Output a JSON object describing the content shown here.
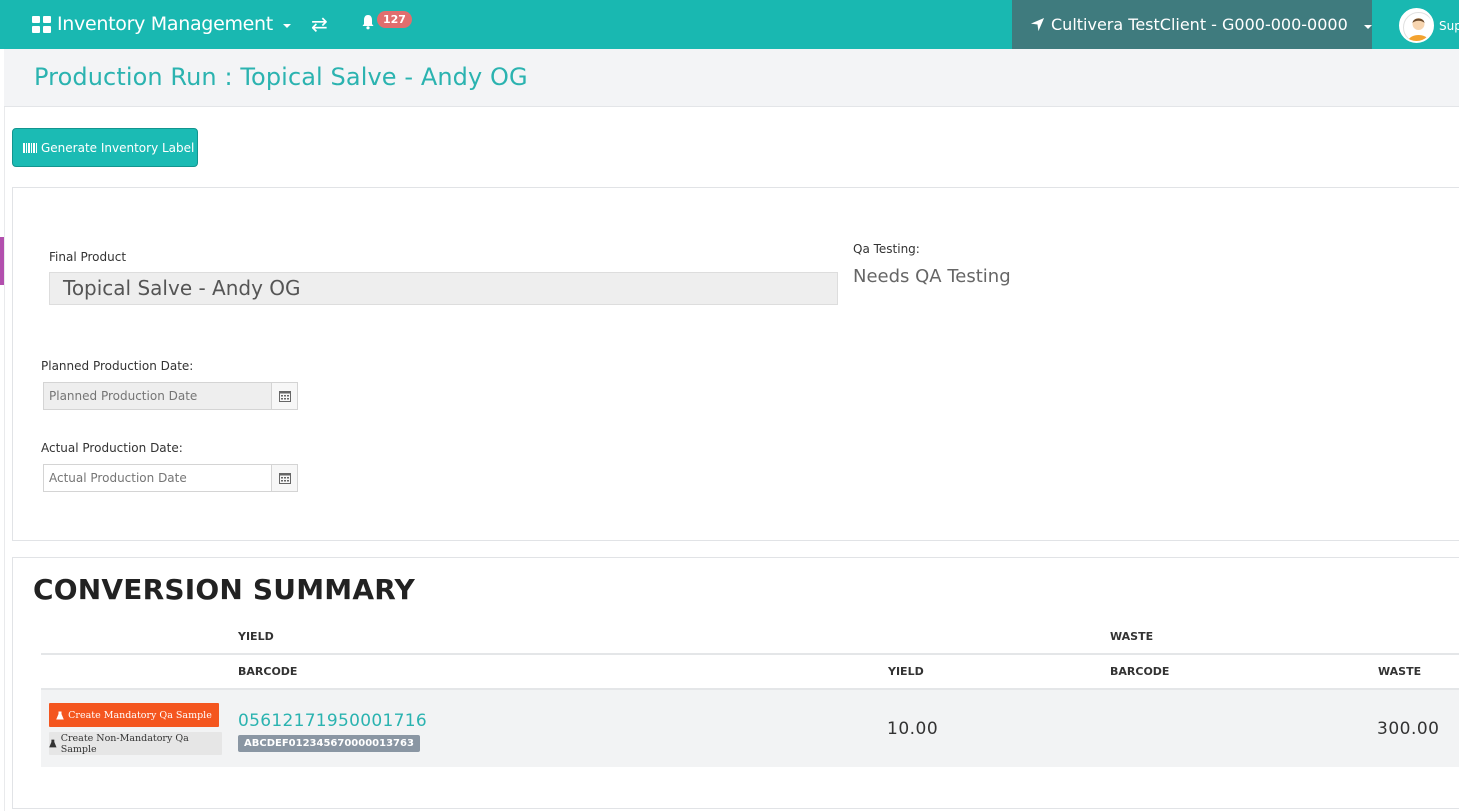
{
  "navbar": {
    "app_title": "Inventory Management",
    "notification_count": "127",
    "location": "Cultivera TestClient - G000-000-0000",
    "user_label": "Sup",
    "icons": {
      "app": "grid-icon",
      "swap": "swap-icon",
      "notifications": "bell-icon",
      "location": "location-arrow-icon",
      "user": "avatar"
    },
    "colors": {
      "bar": "#19b8b1",
      "location_bg": "#3f7b7e",
      "badge": "#e06e6e"
    }
  },
  "page": {
    "title": "Production Run : Topical Salve - Andy OG"
  },
  "actions": {
    "generate_label": "Generate Inventory Label"
  },
  "form": {
    "final_product_label": "Final Product",
    "final_product_value": "Topical Salve - Andy OG",
    "qa_label": "Qa Testing:",
    "qa_value": "Needs QA Testing",
    "planned_date_label": "Planned Production Date:",
    "planned_date_placeholder": "Planned Production Date",
    "actual_date_label": "Actual Production Date:",
    "actual_date_placeholder": "Actual Production Date"
  },
  "summary": {
    "title": "CONVERSION SUMMARY",
    "group_headers": {
      "yield": "YIELD",
      "waste": "WASTE"
    },
    "columns": {
      "yield_barcode": "BARCODE",
      "yield": "YIELD",
      "waste_barcode": "BARCODE",
      "waste": "WASTE"
    },
    "rows": [
      {
        "mandatory_btn": "Create Mandatory Qa Sample",
        "non_mandatory_btn": "Create Non-Mandatory Qa Sample",
        "barcode": "05612171950001716",
        "barcode_tag": "ABCDEF012345670000013763",
        "yield": "10.00",
        "waste_barcode": "",
        "waste": "300.00"
      }
    ],
    "colors": {
      "accent": "#2bb3b0",
      "mandatory": "#f4561f"
    }
  }
}
